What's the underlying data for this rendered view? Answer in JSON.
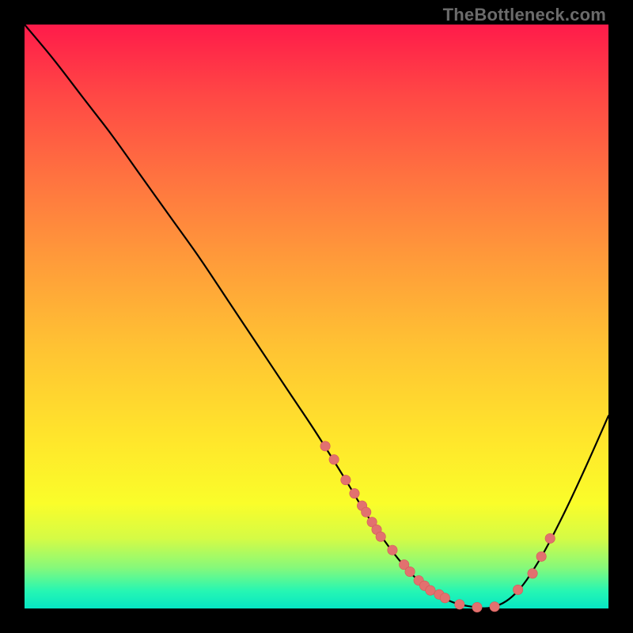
{
  "watermark": "TheBottleneck.com",
  "colors": {
    "curve": "#000000",
    "marker_fill": "#e2716f",
    "marker_stroke": "#d45a58"
  },
  "chart_data": {
    "type": "line",
    "title": "",
    "xlabel": "",
    "ylabel": "",
    "xlim": [
      0,
      100
    ],
    "ylim": [
      0,
      100
    ],
    "grid": false,
    "legend": false,
    "series": [
      {
        "name": "curve",
        "x": [
          0,
          5,
          10,
          15,
          20,
          25,
          30,
          35,
          40,
          45,
          50,
          55,
          58,
          61,
          64,
          67,
          70,
          73,
          76,
          80,
          84,
          88,
          92,
          96,
          100
        ],
        "y": [
          100,
          94,
          87.5,
          81,
          74,
          67,
          60,
          52.5,
          45,
          37.5,
          30,
          22,
          17,
          12.5,
          8.5,
          5.2,
          2.8,
          1.2,
          0.4,
          0.2,
          2.5,
          8,
          15.5,
          24,
          33
        ]
      }
    ],
    "markers": {
      "name": "points",
      "x": [
        51.5,
        53.0,
        55.0,
        56.5,
        57.8,
        58.5,
        59.5,
        60.3,
        61.0,
        63.0,
        65.0,
        66.0,
        67.5,
        68.5,
        69.5,
        71.0,
        72.0,
        74.5,
        77.5,
        80.5,
        84.5,
        87.0,
        88.5,
        90.0
      ],
      "y": [
        27.8,
        25.5,
        22.0,
        19.7,
        17.6,
        16.5,
        14.8,
        13.5,
        12.3,
        10.0,
        7.5,
        6.3,
        4.8,
        3.9,
        3.1,
        2.4,
        1.8,
        0.7,
        0.2,
        0.3,
        3.2,
        6.0,
        8.9,
        12.0
      ]
    }
  }
}
